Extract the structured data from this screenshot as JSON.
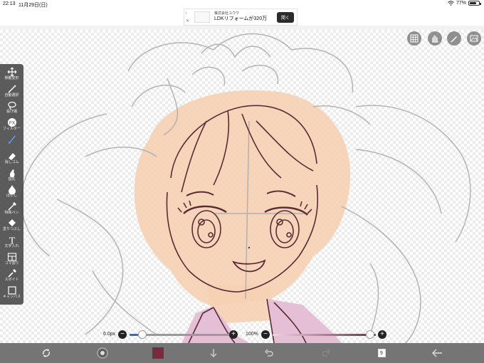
{
  "status_bar": {
    "time": "22:13",
    "date": "11月29日(日)",
    "battery_text": "77%",
    "battery_level": 0.77
  },
  "ad": {
    "info_glyph": "i",
    "close_glyph": "✕",
    "company": "株式会社ユウワ",
    "title": "LDKリフォームが320万",
    "button": "開く"
  },
  "tools": [
    {
      "label": "移動変形",
      "icon": "move-icon"
    },
    {
      "label": "自動選択",
      "icon": "magic-wand-icon"
    },
    {
      "label": "投げ縄",
      "icon": "lasso-icon"
    },
    {
      "label": "フィルター",
      "icon": "fx-icon",
      "glyph": "FX"
    },
    {
      "label": "",
      "icon": "brush-icon",
      "active": true
    },
    {
      "label": "消しゴム",
      "icon": "eraser-icon"
    },
    {
      "label": "指先",
      "icon": "finger-smudge-icon"
    },
    {
      "label": "ぼかし",
      "icon": "blur-drop-icon"
    },
    {
      "label": "特殊ペン",
      "icon": "special-pen-icon"
    },
    {
      "label": "塗りつぶし",
      "icon": "bucket-fill-icon"
    },
    {
      "label": "文字入れ",
      "icon": "text-icon",
      "glyph": "T"
    },
    {
      "label": "コマ割り",
      "icon": "frame-divide-icon"
    },
    {
      "label": "スポイト",
      "icon": "eyedropper-icon"
    },
    {
      "label": "キャンバス",
      "icon": "canvas-icon"
    }
  ],
  "sliders": {
    "brush_size": {
      "label": "6.0px",
      "minus": "−",
      "plus": "+",
      "level": 0.0
    },
    "opacity": {
      "label": "100%",
      "minus": "−",
      "plus": "+",
      "level": 1.0
    }
  },
  "bottom_bar": {
    "color": "#7a2a3c",
    "layer_count": "9"
  },
  "top_tools": [
    "grid-icon",
    "hand-icon",
    "pen-settings-icon",
    "layers-panel-icon"
  ]
}
